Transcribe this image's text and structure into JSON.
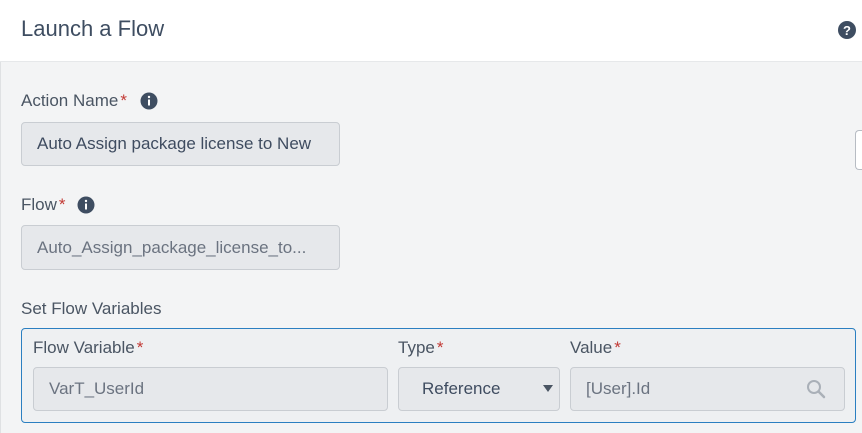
{
  "header": {
    "title": "Launch a Flow",
    "help_icon": "question-circle-icon"
  },
  "action_name": {
    "label": "Action Name",
    "required_mark": "*",
    "info_icon": "info-icon",
    "value": "Auto Assign package license to New"
  },
  "flow": {
    "label": "Flow",
    "required_mark": "*",
    "info_icon": "info-icon",
    "value": "Auto_Assign_package_license_to..."
  },
  "flow_variables": {
    "section_label": "Set Flow Variables",
    "columns": [
      {
        "label": "Flow Variable",
        "required_mark": "*"
      },
      {
        "label": "Type",
        "required_mark": "*"
      },
      {
        "label": "Value",
        "required_mark": "*"
      }
    ],
    "rows": [
      {
        "variable": "VarT_UserId",
        "type": "Reference",
        "value": "[User].Id"
      }
    ]
  },
  "colors": {
    "accent_border": "#2b7fc1",
    "required": "#c23934",
    "title_text": "#3e4d61"
  }
}
